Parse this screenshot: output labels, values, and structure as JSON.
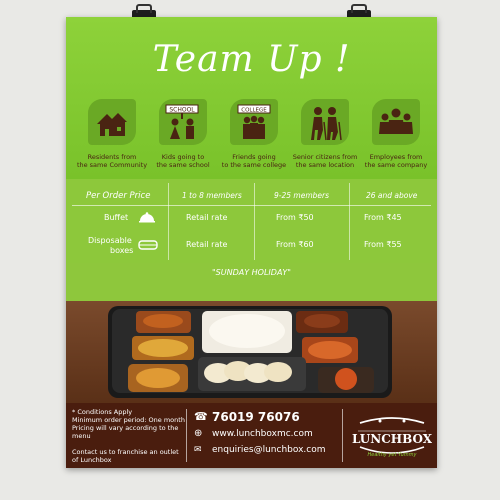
{
  "poster": {
    "title": "Team Up !",
    "icons": [
      {
        "icon": "house-icon",
        "label_1": "Residents from",
        "label_2": "the same Community",
        "sign": ""
      },
      {
        "icon": "school-kids-icon",
        "label_1": "Kids going to",
        "label_2": "the same school",
        "sign": "SCHOOL"
      },
      {
        "icon": "college-friends-icon",
        "label_1": "Friends going",
        "label_2": "to the same college",
        "sign": "COLLEGE"
      },
      {
        "icon": "senior-citizens-icon",
        "label_1": "Senior citizens from",
        "label_2": "the same location",
        "sign": ""
      },
      {
        "icon": "employees-icon",
        "label_1": "Employees from",
        "label_2": "the same company",
        "sign": ""
      }
    ],
    "pricing": {
      "heading": "Per Order Price",
      "columns": [
        "1 to 8 members",
        "9-25 members",
        "26 and above"
      ],
      "rows": [
        {
          "label": "Buffet",
          "icon": "cloche-icon",
          "values": [
            "Retail rate",
            "From ₹50",
            "From ₹45"
          ]
        },
        {
          "label_1": "Disposable",
          "label_2": "boxes",
          "icon": "box-icon",
          "values": [
            "Retail rate",
            "From ₹60",
            "From ₹55"
          ]
        }
      ]
    },
    "sunday": "\"SUNDAY HOLIDAY\"",
    "footer": {
      "conditions": [
        "* Conditions Apply",
        "Minimum order period: One month",
        "Pricing will vary according to the",
        "menu"
      ],
      "franchise": [
        "Contact us to franchise an outlet",
        "of Lunchbox"
      ],
      "phone": "76019 76076",
      "website": "www.lunchboxmc.com",
      "email": "enquiries@lunchbox.com",
      "brand": "LUNCHBOX",
      "tagline": "Healthy yet Yummy"
    }
  },
  "colors": {
    "green": "#8ed23a",
    "brown": "#4a1d0e",
    "icon_brown": "#4a2412",
    "wood": "#6b3a1e"
  }
}
